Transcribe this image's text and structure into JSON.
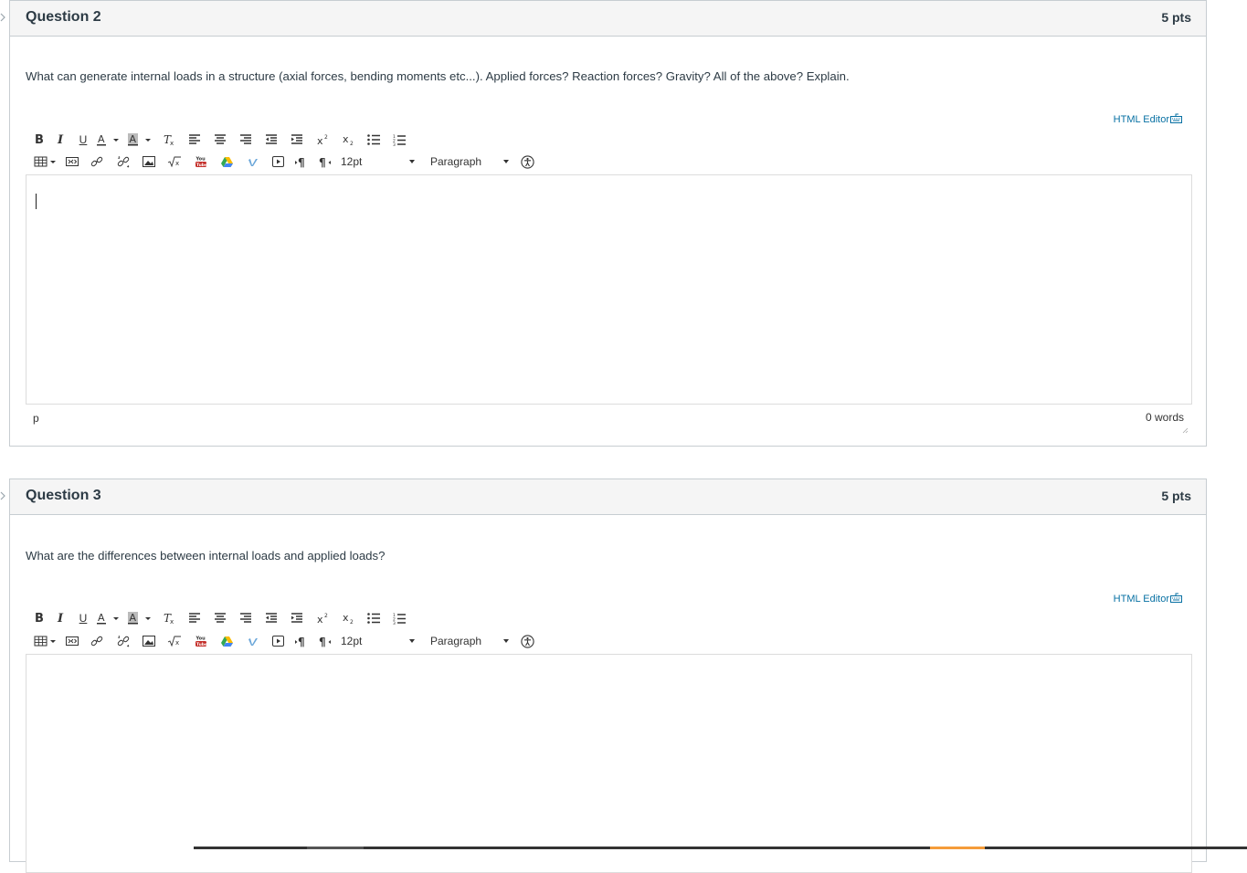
{
  "questions": [
    {
      "title": "Question 2",
      "points": "5 pts",
      "text": "What can generate internal loads in a structure (axial forces, bending moments etc...). Applied forces? Reaction forces? Gravity? All of the above? Explain.",
      "html_editor_label": "HTML Editor",
      "font_size": "12pt",
      "block_format": "Paragraph",
      "status_path": "p",
      "word_count": "0 words"
    },
    {
      "title": "Question 3",
      "points": "5 pts",
      "text": "What are the differences between internal loads and applied loads?",
      "html_editor_label": "HTML Editor",
      "font_size": "12pt",
      "block_format": "Paragraph"
    }
  ],
  "toolbar": {
    "row1_icons": [
      "bold-icon",
      "italic-icon",
      "underline-icon",
      "text-color-icon",
      "background-color-icon",
      "clear-formatting-icon",
      "align-left-icon",
      "align-center-icon",
      "align-right-icon",
      "outdent-icon",
      "indent-icon",
      "superscript-icon",
      "subscript-icon",
      "bullet-list-icon",
      "numbered-list-icon"
    ],
    "row2_icons": [
      "table-icon",
      "embed-media-icon",
      "link-icon",
      "unlink-icon",
      "image-icon",
      "math-equation-icon",
      "youtube-icon",
      "google-drive-icon",
      "vimeo-icon",
      "media-icon",
      "ltr-paragraph-icon",
      "rtl-paragraph-icon",
      "accessibility-icon"
    ]
  },
  "colors": {
    "accent_link": "#0770a3",
    "header_bg": "#f5f5f5",
    "border": "#c7cdd1"
  }
}
